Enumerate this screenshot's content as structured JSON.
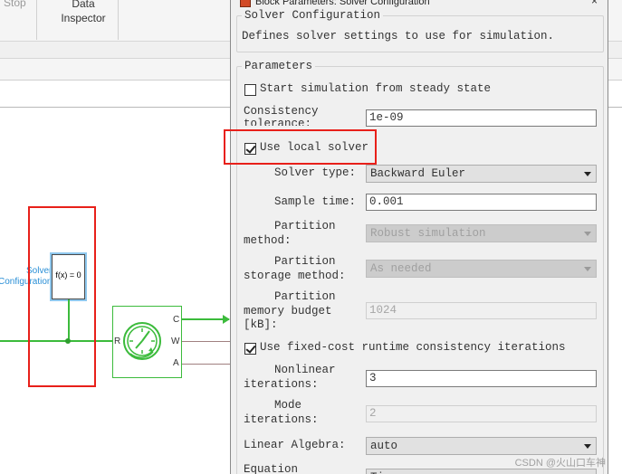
{
  "toolstrip": {
    "stop_label": "Stop",
    "data_inspector_label": "Data Inspector"
  },
  "model": {
    "solver_block_name": [
      "Solver",
      "Configuration"
    ],
    "solver_block_equation": "f(x) = 0",
    "sensor_ports": {
      "input": "R",
      "outputs": [
        "C",
        "W",
        "A"
      ]
    }
  },
  "dialog": {
    "title": "Block Parameters: Solver Configuration",
    "close_glyph": "×",
    "config_group": {
      "legend": "Solver Configuration",
      "description": "Defines solver settings to use for simulation."
    },
    "params_group": {
      "legend": "Parameters",
      "steady_state": {
        "label": "Start simulation from steady state",
        "checked": false
      },
      "consistency_tolerance": {
        "label": [
          "Consistency",
          "tolerance:"
        ],
        "value": "1e-09"
      },
      "use_local_solver": {
        "label": "Use local solver",
        "checked": true
      },
      "solver_type": {
        "label": "Solver type:",
        "value": "Backward Euler"
      },
      "sample_time": {
        "label": "Sample time:",
        "value": "0.001"
      },
      "partition_method": {
        "label": [
          "Partition",
          "method:"
        ],
        "value": "Robust simulation"
      },
      "partition_storage": {
        "label": [
          "Partition",
          "storage method:"
        ],
        "value": "As needed"
      },
      "partition_memory": {
        "label": [
          "Partition",
          "memory budget",
          "[kB]:"
        ],
        "value": "1024"
      },
      "fixed_cost": {
        "label": "Use fixed-cost runtime consistency iterations",
        "checked": true
      },
      "nonlinear_iterations": {
        "label": [
          "Nonlinear",
          "iterations:"
        ],
        "value": "3"
      },
      "mode_iterations": {
        "label": [
          "Mode",
          "iterations:"
        ],
        "value": "2"
      },
      "linear_algebra": {
        "label": "Linear Algebra:",
        "value": "auto"
      },
      "equation_formulation": {
        "label": "Equation",
        "value": "Ti"
      }
    }
  },
  "watermark": "CSDN @火山口车神",
  "colors": {
    "highlight_red": "#e8201a",
    "simscape_green": "#3cbb3c",
    "solver_blue": "#2a8fd6"
  }
}
